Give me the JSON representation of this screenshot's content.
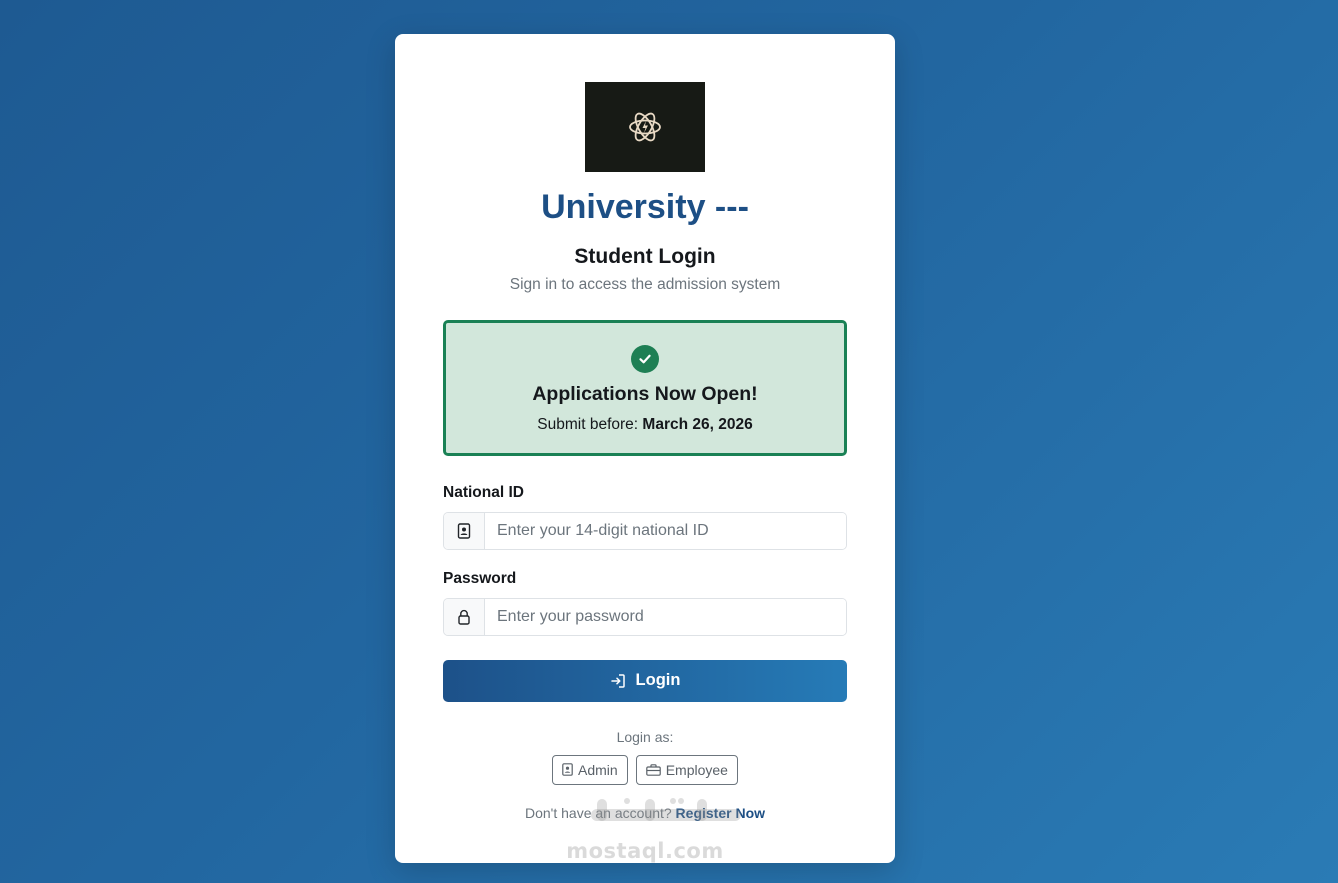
{
  "header": {
    "title": "University ---",
    "subtitle": "Student Login",
    "description": "Sign in to access the admission system"
  },
  "notice": {
    "icon": "check-circle-icon",
    "title": "Applications Now Open!",
    "prefix": "Submit before:",
    "deadline": "March 26, 2026"
  },
  "form": {
    "national_id_label": "National ID",
    "national_id_placeholder": "Enter your 14-digit national ID",
    "password_label": "Password",
    "password_placeholder": "Enter your password",
    "login_label": "Login"
  },
  "roles": {
    "label": "Login as:",
    "admin_label": "Admin",
    "employee_label": "Employee"
  },
  "register": {
    "prompt": "Don't have an account?",
    "link_label": "Register Now"
  },
  "watermark": {
    "text": "mostaql.com"
  },
  "colors": {
    "brand": "#1d4f85",
    "success": "#1e7f54",
    "success_bg": "#d2e7db"
  }
}
